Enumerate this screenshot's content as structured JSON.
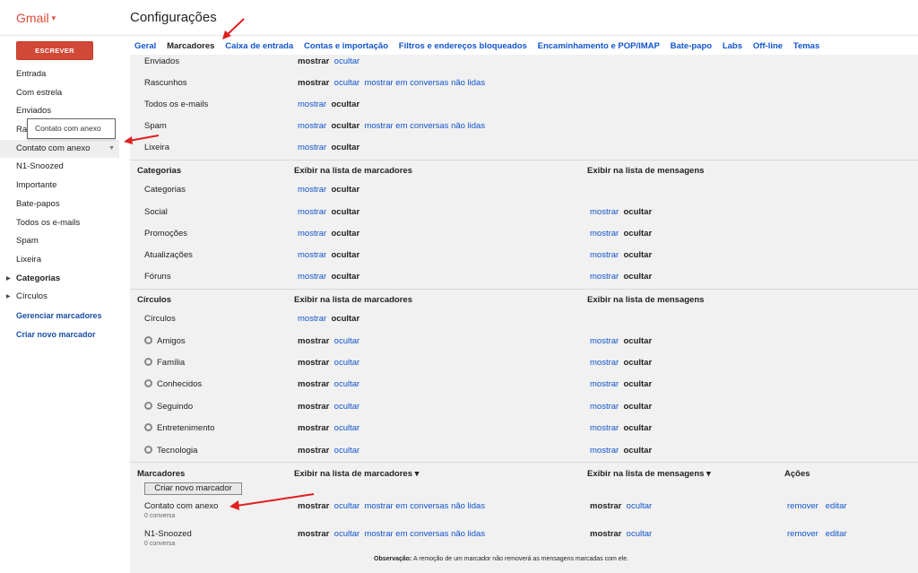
{
  "header": {
    "logo": "Gmail",
    "title": "Configurações"
  },
  "compose_label": "ESCREVER",
  "sidebar": {
    "items": [
      {
        "label": "Entrada"
      },
      {
        "label": "Com estrela"
      },
      {
        "label": "Enviados"
      },
      {
        "label": "Ra"
      },
      {
        "label": "Contato com anexo"
      },
      {
        "label": "N1-Snoozed"
      },
      {
        "label": "Importante"
      },
      {
        "label": "Bate-papos"
      },
      {
        "label": "Todos os e-mails"
      },
      {
        "label": "Spam"
      },
      {
        "label": "Lixeira"
      }
    ],
    "categorias": "Categorias",
    "circulos": "Círculos",
    "gerenciar": "Gerenciar marcadores",
    "criar": "Criar novo marcador"
  },
  "tooltip": "Contato com anexo",
  "tabs": [
    "Geral",
    "Marcadores",
    "Caixa de entrada",
    "Contas e importação",
    "Filtros e endereços bloqueados",
    "Encaminhamento e POP/IMAP",
    "Bate-papo",
    "Labs",
    "Off-line",
    "Temas"
  ],
  "system_labels": [
    {
      "name": "Enviados",
      "l1": "mostrar",
      "l2": "ocultar",
      "l3": ""
    },
    {
      "name": "Rascunhos",
      "l1": "mostrar",
      "l2": "ocultar",
      "l3": "mostrar em conversas não lidas"
    },
    {
      "name": "Todos os e-mails",
      "l1": "mostrar",
      "l2": "ocultar",
      "l3": ""
    },
    {
      "name": "Spam",
      "l1": "mostrar",
      "l2": "ocultar",
      "l3": "mostrar em conversas não lidas"
    },
    {
      "name": "Lixeira",
      "l1": "mostrar",
      "l2": "ocultar",
      "l3": ""
    }
  ],
  "categorias": {
    "title": "Categorias",
    "col1": "Exibir na lista de marcadores",
    "col2": "Exibir na lista de mensagens",
    "rows": [
      {
        "name": "Categorias",
        "m1": "mostrar",
        "o1": "ocultar",
        "m2": "",
        "o2": ""
      },
      {
        "name": "Social",
        "m1": "mostrar",
        "o1": "ocultar",
        "m2": "mostrar",
        "o2": "ocultar"
      },
      {
        "name": "Promoções",
        "m1": "mostrar",
        "o1": "ocultar",
        "m2": "mostrar",
        "o2": "ocultar"
      },
      {
        "name": "Atualizações",
        "m1": "mostrar",
        "o1": "ocultar",
        "m2": "mostrar",
        "o2": "ocultar"
      },
      {
        "name": "Fóruns",
        "m1": "mostrar",
        "o1": "ocultar",
        "m2": "mostrar",
        "o2": "ocultar"
      }
    ]
  },
  "circulos": {
    "title": "Círculos",
    "col1": "Exibir na lista de marcadores",
    "col2": "Exibir na lista de mensagens",
    "rows": [
      {
        "name": "Círculos",
        "m1": "mostrar",
        "o1": "ocultar",
        "m2": "",
        "o2": ""
      },
      {
        "name": "Amigos",
        "m1": "mostrar",
        "o1": "ocultar",
        "m2": "mostrar",
        "o2": "ocultar"
      },
      {
        "name": "Família",
        "m1": "mostrar",
        "o1": "ocultar",
        "m2": "mostrar",
        "o2": "ocultar"
      },
      {
        "name": "Conhecidos",
        "m1": "mostrar",
        "o1": "ocultar",
        "m2": "mostrar",
        "o2": "ocultar"
      },
      {
        "name": "Seguindo",
        "m1": "mostrar",
        "o1": "ocultar",
        "m2": "mostrar",
        "o2": "ocultar"
      },
      {
        "name": "Entretenimento",
        "m1": "mostrar",
        "o1": "ocultar",
        "m2": "mostrar",
        "o2": "ocultar"
      },
      {
        "name": "Tecnologia",
        "m1": "mostrar",
        "o1": "ocultar",
        "m2": "mostrar",
        "o2": "ocultar"
      }
    ]
  },
  "marcadores": {
    "title": "Marcadores",
    "col1": "Exibir na lista de marcadores ▾",
    "col2": "Exibir na lista de mensagens ▾",
    "col3": "Ações",
    "create_button": "Criar novo marcador",
    "rows": [
      {
        "name": "Contato com anexo",
        "count": "0 conversa",
        "m1": "mostrar",
        "o1": "ocultar",
        "u1": "mostrar em conversas não lidas",
        "m2": "mostrar",
        "o2": "ocultar",
        "remove": "remover",
        "edit": "editar"
      },
      {
        "name": "N1-Snoozed",
        "count": "0 conversa",
        "m1": "mostrar",
        "o1": "ocultar",
        "u1": "mostrar em conversas não lidas",
        "m2": "mostrar",
        "o2": "ocultar",
        "remove": "remover",
        "edit": "editar"
      }
    ]
  },
  "note": {
    "label": "Observação:",
    "text": "A remoção de um marcador não removerá as mensagens marcadas com ele."
  },
  "colors": {
    "link": "#1155cc",
    "compose": "#d14836",
    "logo": "#dd4b39",
    "arrow": "#e02020"
  }
}
